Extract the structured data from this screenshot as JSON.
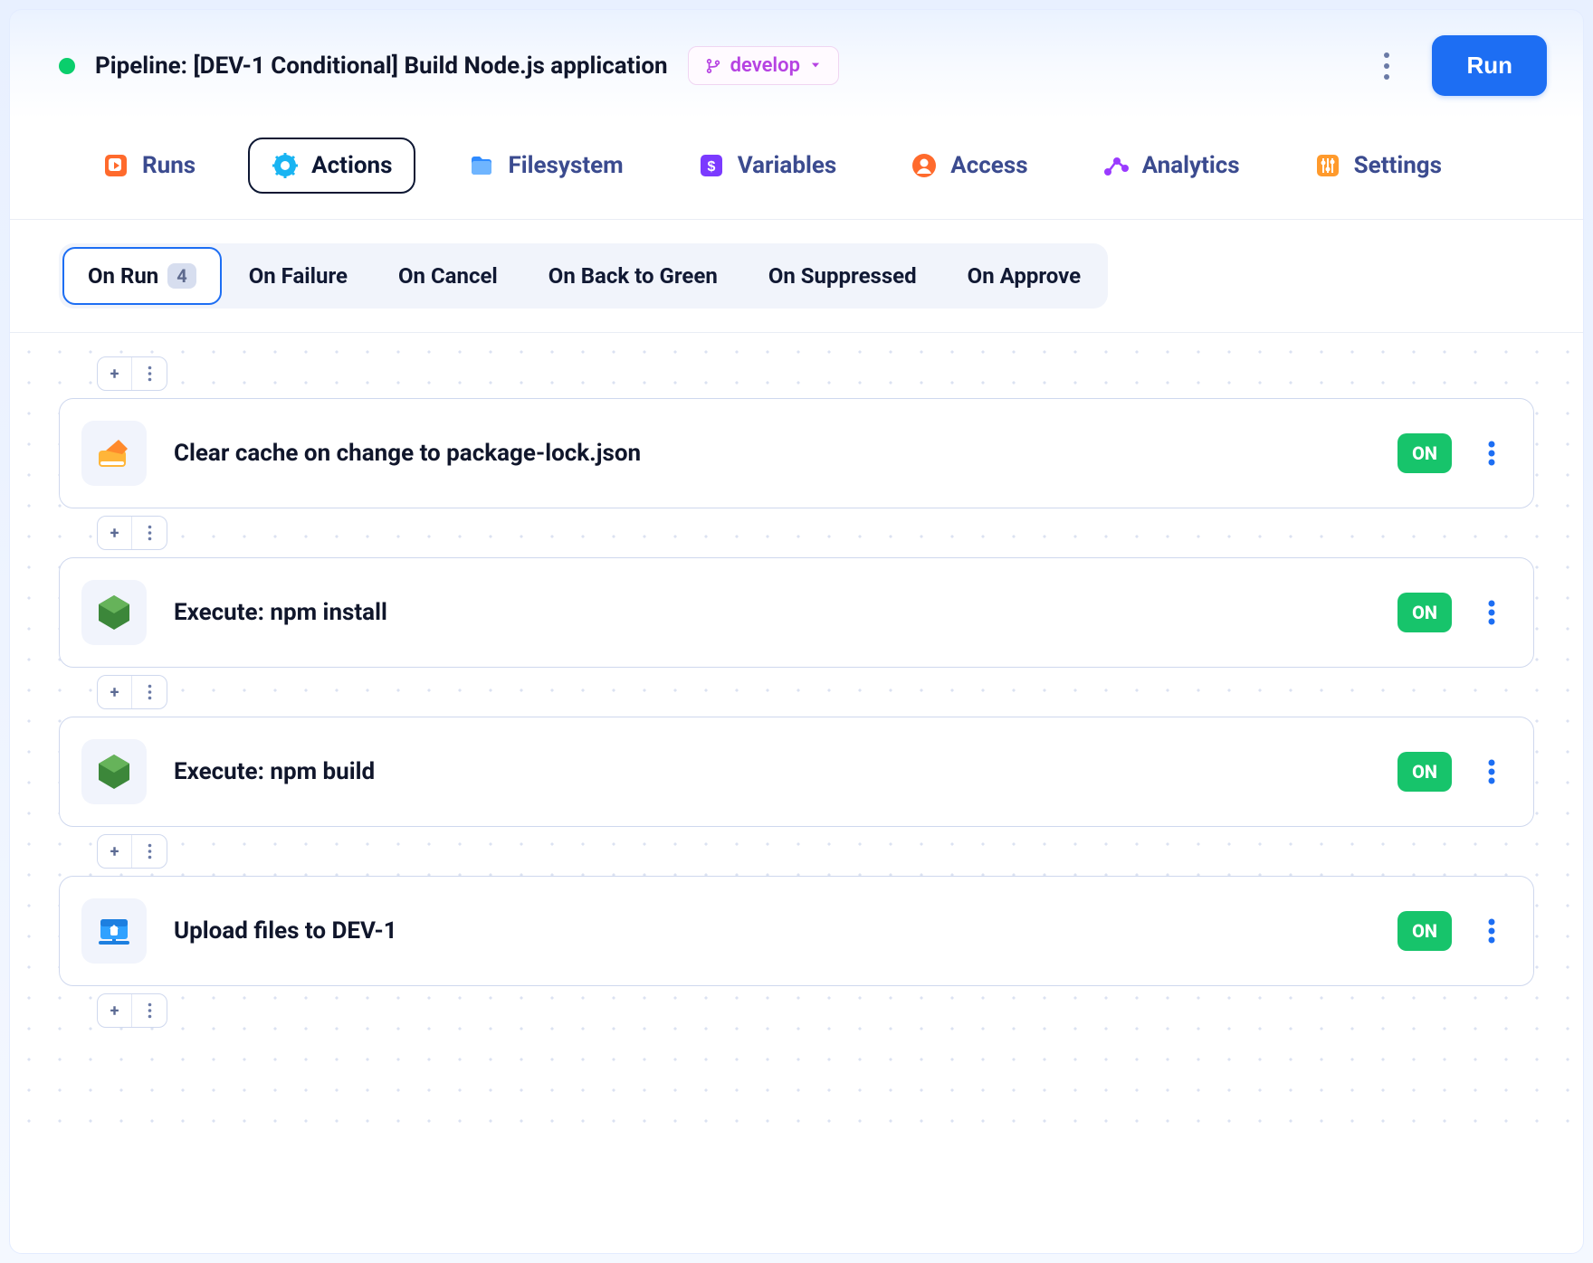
{
  "header": {
    "title": "Pipeline: [DEV-1 Conditional] Build Node.js application",
    "branch": "develop",
    "run_label": "Run"
  },
  "main_tabs": [
    {
      "id": "runs",
      "label": "Runs"
    },
    {
      "id": "actions",
      "label": "Actions",
      "active": true
    },
    {
      "id": "filesystem",
      "label": "Filesystem"
    },
    {
      "id": "variables",
      "label": "Variables"
    },
    {
      "id": "access",
      "label": "Access"
    },
    {
      "id": "analytics",
      "label": "Analytics"
    },
    {
      "id": "settings",
      "label": "Settings"
    }
  ],
  "sub_tabs": [
    {
      "id": "on_run",
      "label": "On Run",
      "count": "4",
      "active": true
    },
    {
      "id": "on_failure",
      "label": "On Failure"
    },
    {
      "id": "on_cancel",
      "label": "On Cancel"
    },
    {
      "id": "on_back_to_green",
      "label": "On Back to Green"
    },
    {
      "id": "on_suppressed",
      "label": "On Suppressed"
    },
    {
      "id": "on_approve",
      "label": "On Approve"
    }
  ],
  "actions": [
    {
      "icon": "clear-cache",
      "title": "Clear cache on change to package-lock.json",
      "status": "ON"
    },
    {
      "icon": "node",
      "title": "Execute: npm install",
      "status": "ON"
    },
    {
      "icon": "node",
      "title": "Execute: npm build",
      "status": "ON"
    },
    {
      "icon": "upload",
      "title": "Upload files to DEV-1",
      "status": "ON"
    }
  ],
  "icons": {
    "colors": {
      "runs": "#ff6a2c",
      "actions": "#19b4f2",
      "filesystem": "#2f8bff",
      "variables": "#7b3aff",
      "access": "#ff6a2c",
      "analytics": "#9a3aff",
      "settings": "#ff9a2c"
    }
  }
}
